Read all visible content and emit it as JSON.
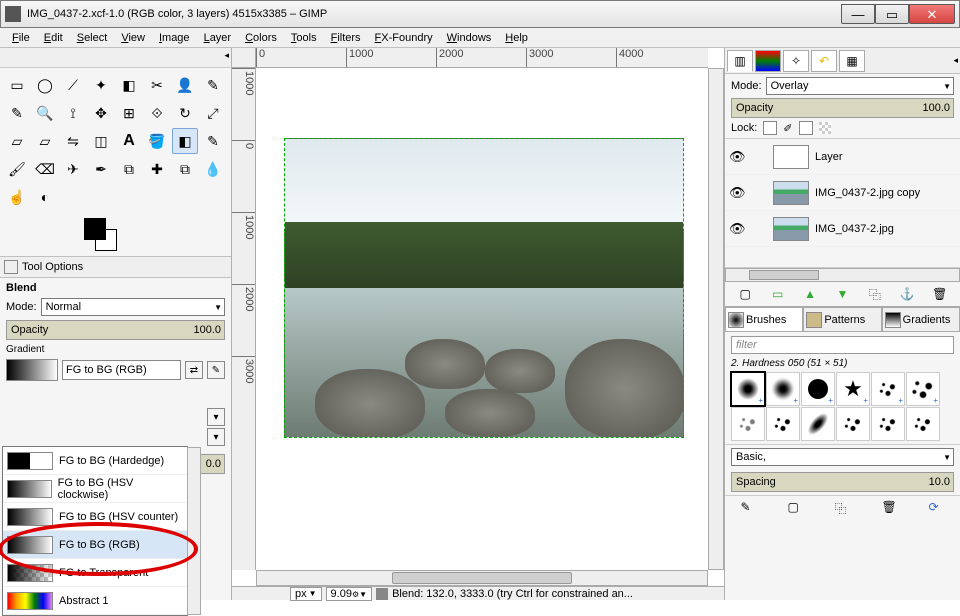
{
  "window": {
    "title": "IMG_0437-2.xcf-1.0 (RGB color, 3 layers) 4515x3385 – GIMP"
  },
  "menu": [
    "File",
    "Edit",
    "Select",
    "View",
    "Image",
    "Layer",
    "Colors",
    "Tools",
    "Filters",
    "FX-Foundry",
    "Windows",
    "Help"
  ],
  "toolbox": {
    "tools": [
      "rect-select-icon",
      "ellipse-select-icon",
      "free-select-icon",
      "fuzzy-select-icon",
      "by-color-select-icon",
      "scissors-icon",
      "foreground-select-icon",
      "paths-icon",
      "color-picker-icon",
      "zoom-icon",
      "measure-icon",
      "move-icon",
      "align-icon",
      "crop-icon",
      "rotate-icon",
      "scale-icon",
      "shear-icon",
      "perspective-icon",
      "flip-icon",
      "cage-icon",
      "text-icon",
      "bucket-fill-icon",
      "blend-icon",
      "pencil-icon",
      "paintbrush-icon",
      "eraser-icon",
      "airbrush-icon",
      "ink-icon",
      "clone-icon",
      "heal-icon",
      "perspective-clone-icon",
      "blur-icon",
      "smudge-icon",
      "dodge-icon"
    ],
    "active": "blend-icon"
  },
  "tool_options": {
    "header": "Tool Options",
    "title": "Blend",
    "mode_label": "Mode:",
    "mode_value": "Normal",
    "opacity_label": "Opacity",
    "opacity_value": "100.0",
    "gradient_label": "Gradient",
    "gradient_value": "FG to BG (RGB)",
    "offset_value": "0.0",
    "gradient_list": [
      {
        "name": "FG to BG (Hardedge)",
        "style": "gi-hard"
      },
      {
        "name": "FG to BG (HSV clockwise)",
        "style": "gi-soft"
      },
      {
        "name": "FG to BG (HSV counter)",
        "style": "gi-soft"
      },
      {
        "name": "FG to BG (RGB)",
        "style": "gi-soft",
        "selected": true
      },
      {
        "name": "FG to Transparent",
        "style": "gi-trans"
      },
      {
        "name": "Abstract 1",
        "style": "gi-rainbow"
      }
    ]
  },
  "canvas": {
    "ruler_h": [
      "0",
      "1000",
      "2000",
      "3000",
      "4000"
    ],
    "ruler_v": [
      "1000",
      "0",
      "1000",
      "2000",
      "3000"
    ],
    "unit": "px",
    "zoom": "9.09",
    "status": "Blend: 132.0, 3333.0 (try Ctrl for constrained an..."
  },
  "layers_panel": {
    "mode_label": "Mode:",
    "mode_value": "Overlay",
    "opacity_label": "Opacity",
    "opacity_value": "100.0",
    "lock_label": "Lock:",
    "layers": [
      {
        "name": "Layer",
        "kind": "white"
      },
      {
        "name": "IMG_0437-2.jpg copy",
        "kind": "img"
      },
      {
        "name": "IMG_0437-2.jpg",
        "kind": "img"
      }
    ]
  },
  "brushes_panel": {
    "tabs": [
      "Brushes",
      "Patterns",
      "Gradients"
    ],
    "filter_placeholder": "filter",
    "current": "2. Hardness 050 (51 × 51)",
    "basic_label": "Basic,",
    "spacing_label": "Spacing",
    "spacing_value": "10.0"
  }
}
